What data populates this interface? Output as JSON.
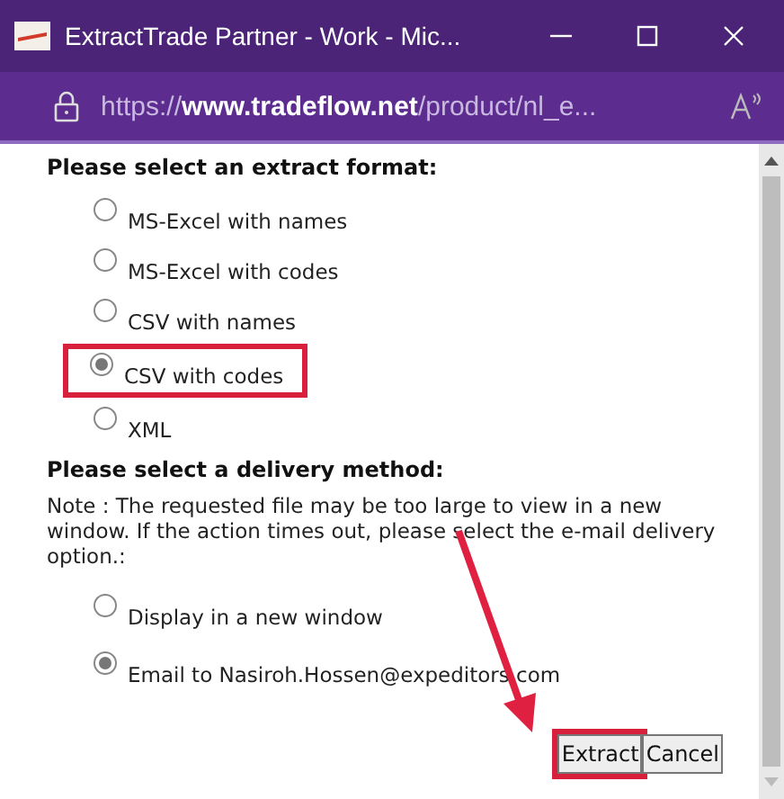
{
  "window": {
    "title": "ExtractTrade Partner - Work - Mic..."
  },
  "address_bar": {
    "scheme": "https://",
    "domain": "www.tradeflow.net",
    "path": "/product/nl_e..."
  },
  "format_section": {
    "heading": "Please select an extract format:",
    "options": [
      {
        "label": "MS-Excel with names",
        "selected": false,
        "highlighted": false
      },
      {
        "label": "MS-Excel with codes",
        "selected": false,
        "highlighted": false
      },
      {
        "label": "CSV with names",
        "selected": false,
        "highlighted": false
      },
      {
        "label": "CSV with codes",
        "selected": true,
        "highlighted": true
      },
      {
        "label": "XML",
        "selected": false,
        "highlighted": false
      }
    ]
  },
  "delivery_section": {
    "heading": "Please select a delivery method:",
    "note": "Note : The requested file may be too large to view in a new window. If the action times out, please select the e-mail delivery option.:",
    "options": [
      {
        "label": "Display in a new window",
        "selected": false
      },
      {
        "label": "Email to Nasiroh.Hossen@expeditors.com",
        "selected": true
      }
    ]
  },
  "buttons": [
    {
      "label": "Extract",
      "highlighted": true
    },
    {
      "label": "Cancel",
      "highlighted": false
    }
  ]
}
